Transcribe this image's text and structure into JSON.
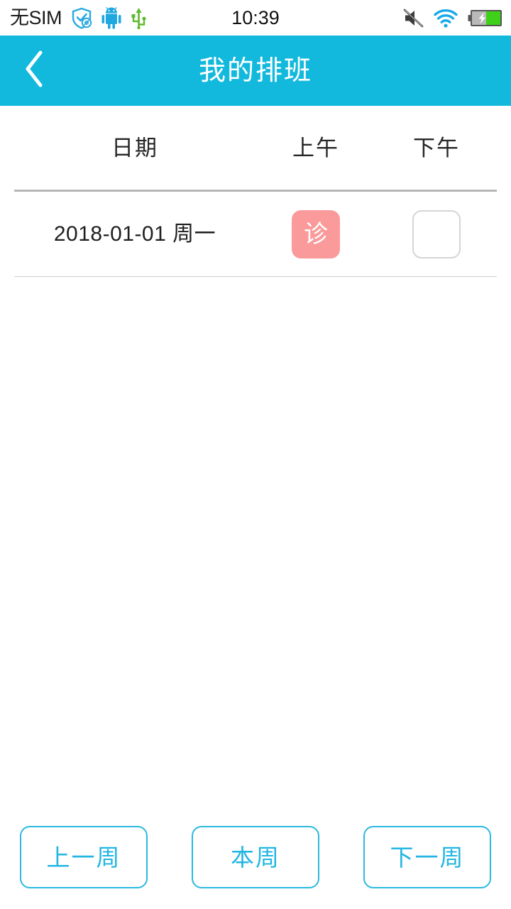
{
  "status_bar": {
    "carrier": "无SIM",
    "clock": "10:39",
    "icons_left": [
      "shield-check-icon",
      "android-robot-icon",
      "usb-icon"
    ],
    "icons_right": [
      "mute-volume-icon",
      "wifi-icon",
      "battery-charging-icon"
    ],
    "battery": {
      "charging": true,
      "level_percent": 45,
      "fill_color": "#3fd11a"
    }
  },
  "header": {
    "back_icon": "chevron-left-icon",
    "title": "我的排班",
    "background_color": "#13b9dd",
    "text_color": "#ffffff"
  },
  "schedule": {
    "columns": [
      "日期",
      "上午",
      "下午"
    ],
    "rows": [
      {
        "date": "2018-01-01 周一",
        "am": {
          "label": "诊",
          "filled": true,
          "color": "#fa9a9a"
        },
        "pm": {
          "label": "",
          "filled": false,
          "color": "#ffffff"
        }
      }
    ]
  },
  "footer": {
    "buttons": [
      {
        "label": "上一周",
        "name": "prev-week-button"
      },
      {
        "label": "本周",
        "name": "current-week-button"
      },
      {
        "label": "下一周",
        "name": "next-week-button"
      }
    ],
    "accent_color": "#23b6e2"
  }
}
